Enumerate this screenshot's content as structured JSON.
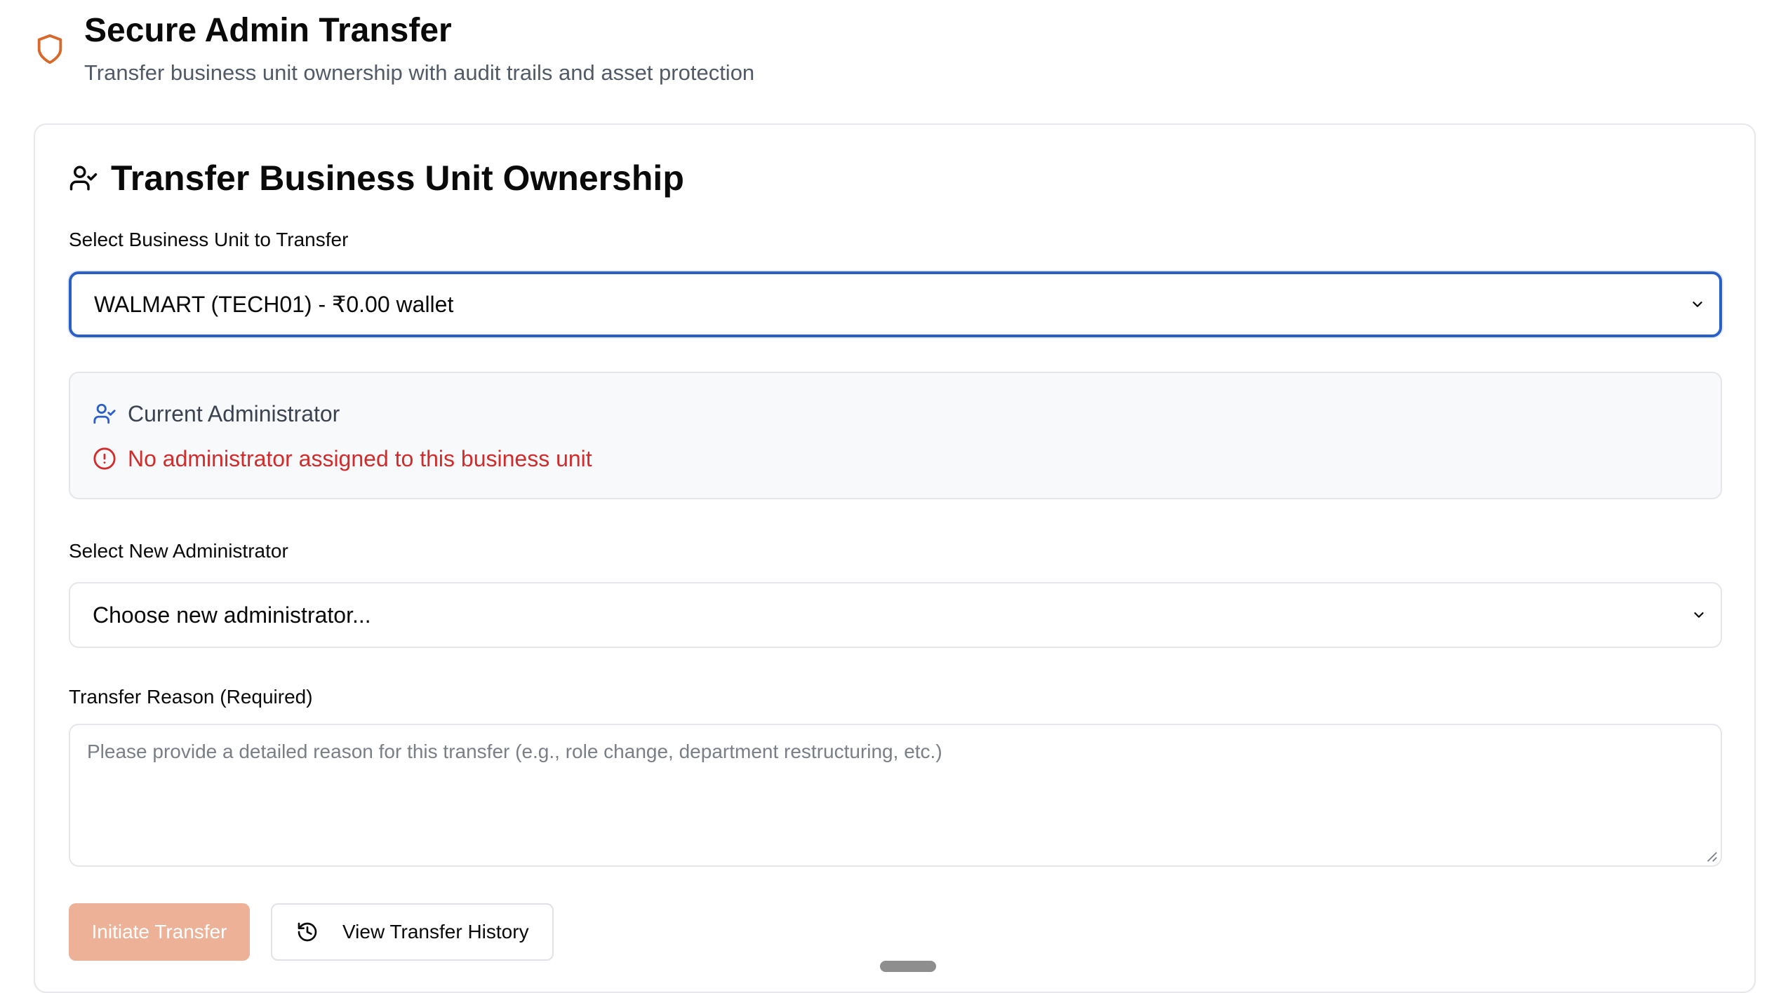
{
  "header": {
    "icon": "shield-icon",
    "title": "Secure Admin Transfer",
    "subtitle": "Transfer business unit ownership with audit trails and asset protection"
  },
  "card": {
    "title_icon": "user-check-icon",
    "title": "Transfer Business Unit Ownership",
    "business_unit": {
      "label": "Select Business Unit to Transfer",
      "selected_value": "WALMART (TECH01) - ₹0.00 wallet"
    },
    "current_admin": {
      "icon": "user-check-icon",
      "heading": "Current Administrator",
      "warning_icon": "alert-circle-icon",
      "warning": "No administrator assigned to this business unit"
    },
    "new_admin": {
      "label": "Select New Administrator",
      "selected_value": "Choose new administrator..."
    },
    "reason": {
      "label": "Transfer Reason (Required)",
      "placeholder": "Please provide a detailed reason for this transfer (e.g., role change, department restructuring, etc.)",
      "value": ""
    },
    "actions": {
      "primary_label": "Initiate Transfer",
      "secondary_label": "View Transfer History",
      "secondary_icon": "history-icon"
    }
  },
  "colors": {
    "accent_orange": "#d9682b",
    "primary_button_disabled": "#ecb197",
    "focus_blue": "#2b5fc8",
    "warning_red": "#d22b2b",
    "info_blue": "#2b5fc8"
  }
}
